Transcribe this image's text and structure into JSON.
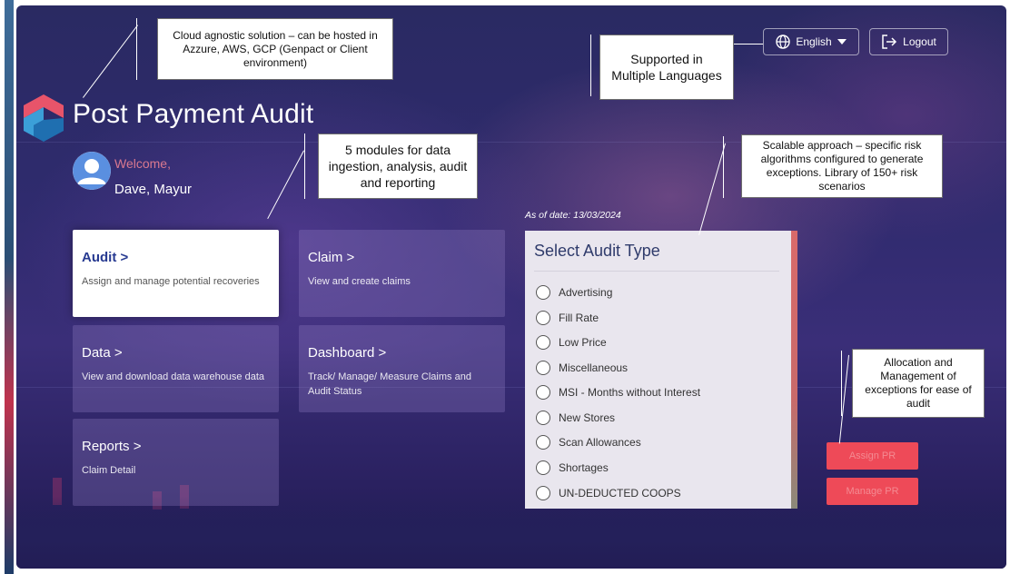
{
  "header": {
    "app_title": "Post Payment Audit",
    "language": "English",
    "logout": "Logout"
  },
  "user": {
    "welcome": "Welcome,",
    "name": "Dave, Mayur"
  },
  "modules": [
    {
      "title": "Audit >",
      "description": "Assign and manage potential recoveries",
      "active": true
    },
    {
      "title": "Claim >",
      "description": "View and create claims",
      "active": false
    },
    {
      "title": "Data >",
      "description": "View and download data warehouse data",
      "active": false
    },
    {
      "title": "Dashboard >",
      "description": "Track/ Manage/ Measure Claims and Audit Status",
      "active": false
    },
    {
      "title": "Reports >",
      "description": "Claim Detail",
      "active": false
    }
  ],
  "audit_panel": {
    "as_of": "As of date: 13/03/2024",
    "title": "Select Audit Type",
    "options": [
      "Advertising",
      "Fill Rate",
      "Low Price",
      "Miscellaneous",
      "MSI - Months without Interest",
      "New Stores",
      "Scan Allowances",
      "Shortages",
      "UN-DEDUCTED COOPS"
    ]
  },
  "actions": {
    "assign_pr": "Assign PR",
    "manage_pr": "Manage PR"
  },
  "callouts": {
    "cloud": "Cloud agnostic solution – can be hosted in Azzure, AWS, GCP (Genpact or Client environment)",
    "languages": "Supported in Multiple Languages",
    "modules": "5 modules for data ingestion, analysis, audit and reporting",
    "scalable": "Scalable approach – specific risk algorithms configured to generate exceptions. Library of 150+ risk scenarios",
    "allocation": "Allocation and Management of exceptions for ease of audit"
  },
  "colors": {
    "accent_blue": "#273a91",
    "welcome_pink": "#d9788f",
    "action_red": "#ee4a58",
    "background_purple": "#2f2b6e"
  }
}
